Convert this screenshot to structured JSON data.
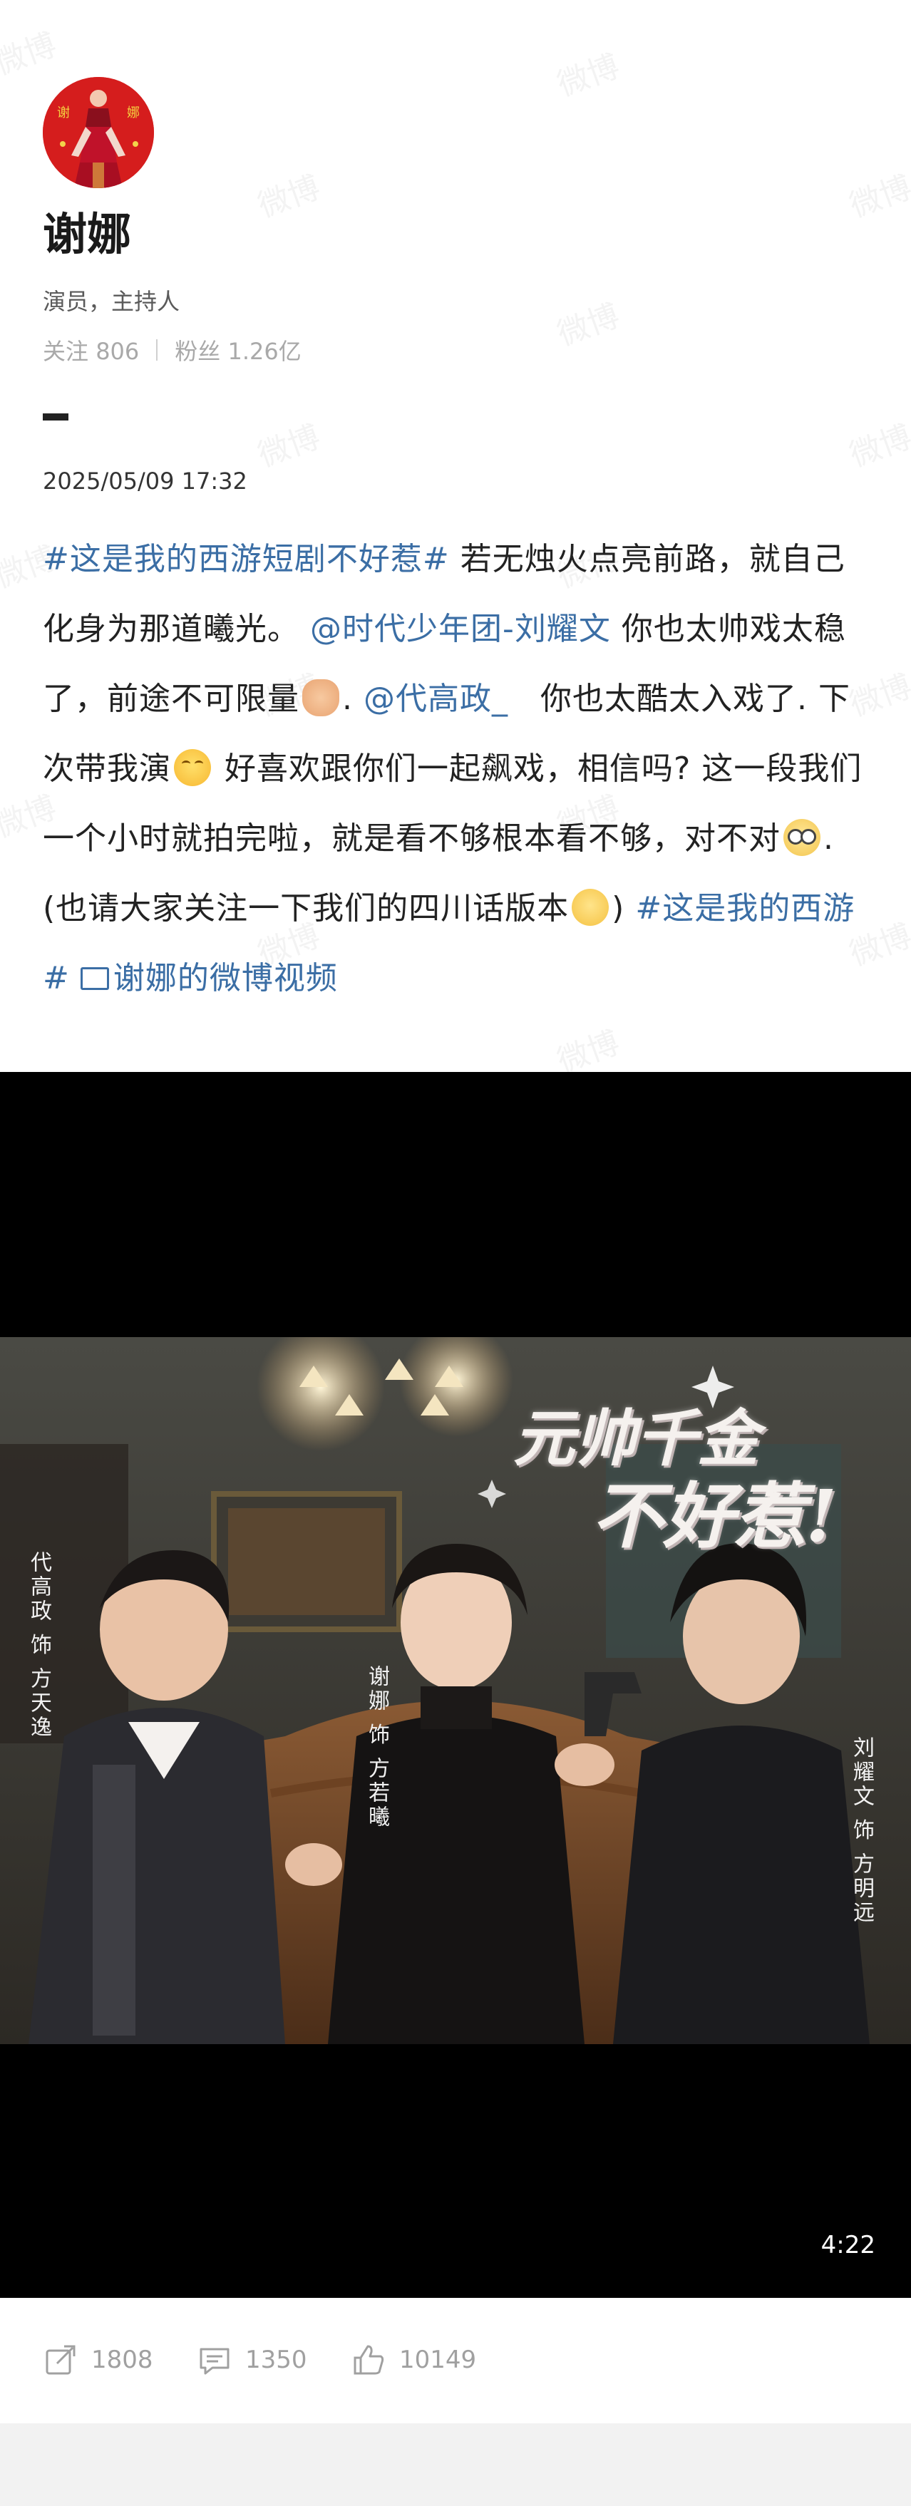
{
  "profile": {
    "name": "谢娜",
    "description": "演员，主持人",
    "following_label": "关注",
    "following_count": "806",
    "followers_label": "粉丝",
    "followers_count": "1.26亿",
    "avatar_text_left": "谢",
    "avatar_text_right": "娜"
  },
  "post": {
    "timestamp": "2025/05/09 17:32",
    "hashtag_1": "#这是我的西游短剧不好惹#",
    "text_1": " 若无烛火点亮前路，就自己化身为那道曦光。 ",
    "mention_1": "@时代少年团-刘耀文",
    "text_2": " 你也太帅戏太稳了，前途不可限量",
    "text_3": ". ",
    "mention_2": "@代高政_",
    "text_4": "　你也太酷太入戏了. 下次带我演",
    "text_5": " 好喜欢跟你们一起飙戏，相信吗? 这一段我们一个小时就拍完啦，就是看不够根本看不够，对不对",
    "text_6": ". (也请大家关注一下我们的四川话版本",
    "text_7": ") ",
    "hashtag_2": "#这是我的西游#",
    "video_link": "谢娜的微博视频"
  },
  "video": {
    "duration": "4:22",
    "poster_title_1": "元帅千金",
    "poster_title_2": "不好惹!",
    "cast_left": "代高政 饰 方天逸",
    "cast_center": "谢娜 饰 方若曦",
    "cast_right": "刘耀文 饰 方明远"
  },
  "actions": {
    "repost_count": "1808",
    "comment_count": "1350",
    "like_count": "10149"
  },
  "watermark_text": "微博",
  "colors": {
    "link": "#3b6ea5",
    "muted": "#a9a9a9",
    "avatar_red": "#d51d1d"
  }
}
